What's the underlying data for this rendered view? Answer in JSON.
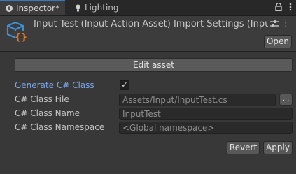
{
  "tabs": {
    "inspector_label": "Inspector*",
    "lighting_label": "Lighting"
  },
  "header": {
    "title": "Input Test (Input Action Asset) Import Settings (Input",
    "open_label": "Open"
  },
  "edit_asset_label": "Edit asset",
  "fields": {
    "generate_label": "Generate C# Class",
    "generate_checked": true,
    "class_file_label": "C# Class File",
    "class_file_value": "Assets/Input/InputTest.cs",
    "browse_label": "...",
    "class_name_label": "C# Class Name",
    "class_name_value": "InputTest",
    "namespace_label": "C# Class Namespace",
    "namespace_placeholder": "<Global namespace>"
  },
  "buttons": {
    "revert_label": "Revert",
    "apply_label": "Apply"
  },
  "icons": {
    "inspector_tab": "info-icon",
    "lighting_tab": "bulb-icon",
    "lock": "lock-icon",
    "menu": "kebab-menu-icon",
    "asset": "input-action-asset-icon",
    "settings": "preset-settings-icon",
    "more": "more-menu-icon"
  },
  "colors": {
    "accent": "#3a79bb",
    "highlight_label": "#7aa7e8",
    "asset_icon_blue": "#3b8fd6",
    "asset_icon_orange": "#e5762b"
  }
}
